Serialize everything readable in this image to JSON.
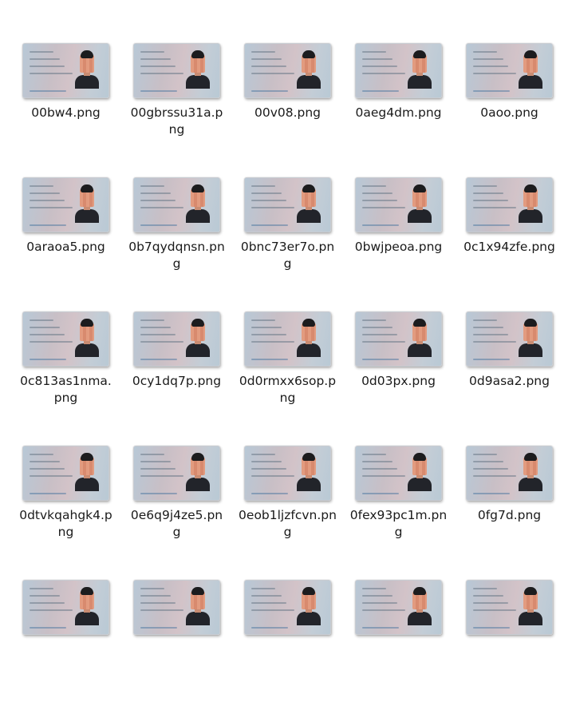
{
  "files": [
    {
      "name": "00bw4.png"
    },
    {
      "name": "00gbrssu31a.png"
    },
    {
      "name": "00v08.png"
    },
    {
      "name": "0aeg4dm.png"
    },
    {
      "name": "0aoo.png"
    },
    {
      "name": "0araoa5.png"
    },
    {
      "name": "0b7qydqnsn.png"
    },
    {
      "name": "0bnc73er7o.png"
    },
    {
      "name": "0bwjpeoa.png"
    },
    {
      "name": "0c1x94zfe.png"
    },
    {
      "name": "0c813as1nma.png"
    },
    {
      "name": "0cy1dq7p.png"
    },
    {
      "name": "0d0rmxx6sop.png"
    },
    {
      "name": "0d03px.png"
    },
    {
      "name": "0d9asa2.png"
    },
    {
      "name": "0dtvkqahgk4.png"
    },
    {
      "name": "0e6q9j4ze5.png"
    },
    {
      "name": "0eob1ljzfcvn.png"
    },
    {
      "name": "0fex93pc1m.png"
    },
    {
      "name": "0fg7d.png"
    },
    {
      "name": ""
    },
    {
      "name": ""
    },
    {
      "name": ""
    },
    {
      "name": ""
    },
    {
      "name": ""
    }
  ],
  "thumbnail_icon": "id-card-image-thumbnail-icon"
}
